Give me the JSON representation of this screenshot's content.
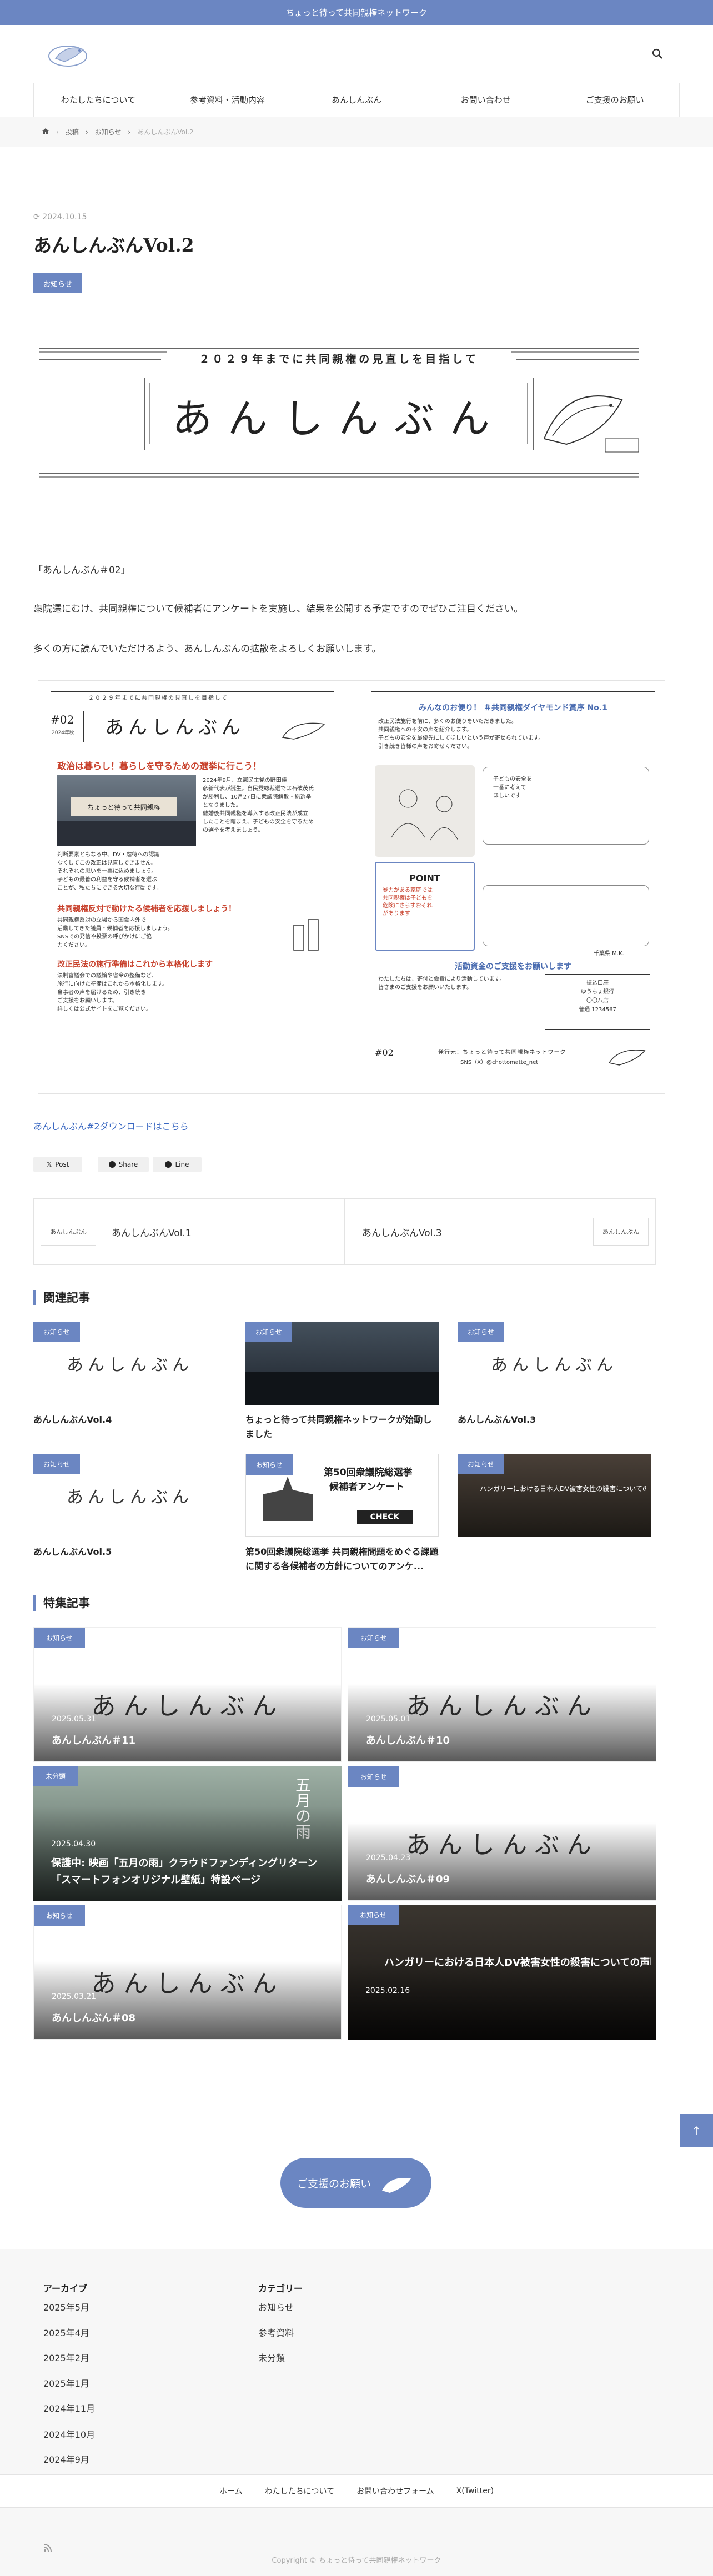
{
  "topbar": {
    "text": "ちょっと待って共同親権ネットワーク"
  },
  "nav": [
    "わたしたちについて",
    "参考資料・活動内容",
    "あんしんぶん",
    "お問い合わせ",
    "ご支援のお願い"
  ],
  "breadcrumb": {
    "items": [
      "投稿",
      "お知らせ"
    ],
    "current": "あんしんぶんVol.2"
  },
  "post": {
    "date": "2024.10.15",
    "title": "あんしんぶんVol.2",
    "category": "お知らせ"
  },
  "hero": {
    "tagline": "２０２９年までに共同親権の見直しを目指して",
    "title": "あんしんぶん"
  },
  "body": {
    "p1": "「あんしんぶん＃02」",
    "p2": "衆院選にむけ、共同親権について候補者にアンケートを実施し、結果を公開する予定ですのでぜひご注目ください。",
    "p3": "多くの方に読んでいただけるよう、あんしんぶんの拡散をよろしくお願いします。"
  },
  "newsletter": {
    "tagline": "２０２９年までに共同親権の見直しを目指して",
    "issue": "#02",
    "issue_sub": "2024年秋",
    "name": "あんしんぶん",
    "h1": "政治は暮らし！暮らしを守るための選挙に行こう！",
    "photo_caption": "ちょっと待って共同親権",
    "lines1": [
      "2024年9月、立憲民主党の野田佳",
      "彦新代表が誕生。自民党総裁選では石破茂氏",
      "が勝利し、10月27日に衆議院解散・総選挙",
      "となりました。"
    ],
    "lines2": [
      "離婚後共同親権を導入する改正民法が成立",
      "したことを踏まえ、子どもの安全を守るため",
      "の選挙を考えましょう。"
    ],
    "lines3": [
      "判断要素ともなる中、DV・虐待への認識",
      "なくしてこの改正は見直しできません。",
      "それぞれの思いを一票に込めましょう。"
    ],
    "lines4": [
      "子どもの最善の利益を守る候補者を選ぶ",
      "ことが、私たちにできる大切な行動です。"
    ],
    "h2": "共同親権反対で動けたる候補者を応援しましょう！",
    "lines5": [
      "共同親権反対の立場から国会内外で",
      "活動してきた議員・候補者を応援しましょう。"
    ],
    "lines6": [
      "SNSでの発信や投票の呼びかけにご協",
      "力ください。"
    ],
    "h3": "改正民法の施行準備はこれから本格化します",
    "lines7": [
      "法制審議会での議論や省令の整備など、",
      "施行に向けた準備はこれから本格化します。"
    ],
    "lines8": [
      "当事者の声を届けるため、引き続き",
      "ご支援をお願いします。"
    ],
    "lines9": [
      "詳しくは公式サイトをご覧ください。"
    ],
    "right_h1": "みんなのお便り！ ＃共同親権ダイヤモンド賞序 No.1",
    "right_lines": [
      "改正民法施行を前に、多くのお便りをいただきました。",
      "共同親権への不安の声を紹介します。",
      "子どもの安全を最優先にしてほしいという声が寄せられています。",
      "引き続き皆様の声をお寄せください。"
    ],
    "point": "POINT",
    "point_lines": [
      "暴力がある家庭では",
      "共同親権は子どもを",
      "危険にさらすおそれ",
      "があります"
    ],
    "speech_lines": [
      "子どもの安全を",
      "一番に考えて",
      "ほしいです"
    ],
    "signature": "千葉県 M.K.",
    "right_h2": "活動資金のご支援をお願いします",
    "donate_lines": [
      "わたしたちは、寄付と会費により活動しています。",
      "皆さまのご支援をお願いいたします。"
    ],
    "bank_title": "振込口座",
    "bank_lines": [
      "ゆうちょ銀行",
      "〇〇八店",
      "普通 1234567"
    ],
    "footer_left": "#02",
    "footer_center": "発行元：ちょっと待って共同親権ネットワーク",
    "footer_sub": "SNS（X）@chottomatte_net"
  },
  "download_link": "あんしんぶん#2ダウンロードはこちら",
  "share": [
    "Post",
    "Share",
    "Line"
  ],
  "prevnext": {
    "prev": "あんしんぶんVol.1",
    "next": "あんしんぶんVol.3"
  },
  "related": {
    "heading": "関連記事",
    "items": [
      {
        "tag": "お知らせ",
        "title": "あんしんぶんVol.4"
      },
      {
        "tag": "お知らせ",
        "title": "ちょっと待って共同親権ネットワークが始動しました"
      },
      {
        "tag": "お知らせ",
        "title": "あんしんぶんVol.3"
      },
      {
        "tag": "お知らせ",
        "title": "あんしんぶんVol.5"
      },
      {
        "tag": "お知らせ",
        "title": "第50回衆議院総選挙 共同親権問題をめぐる課題に関する各候補者の方針についてのアンケ..."
      },
      {
        "tag": "お知らせ",
        "title": ""
      }
    ]
  },
  "survey_card": {
    "line1": "第50回衆議院総選挙",
    "line2": "候補者アンケート",
    "check": "CHECK"
  },
  "hungary_text": "ハンガリーにおける日本人DV被害女性の殺害についての声明",
  "features": {
    "heading": "特集記事",
    "items": [
      {
        "tag": "お知らせ",
        "date": "2025.05.31",
        "title": "あんしんぶん＃11"
      },
      {
        "tag": "お知らせ",
        "date": "2025.05.01",
        "title": "あんしんぶん＃10"
      },
      {
        "tag": "未分類",
        "date": "2025.04.30",
        "title": "保護中: 映画「五月の雨」クラウドファンディングリターン「スマートフォンオリジナル壁紙」特設ページ"
      },
      {
        "tag": "お知らせ",
        "date": "2025.04.23",
        "title": "あんしんぶん＃09"
      },
      {
        "tag": "お知らせ",
        "date": "2025.03.21",
        "title": "あんしんぶん＃08"
      },
      {
        "tag": "お知らせ",
        "date": "2025.02.16",
        "title": "ハンガリーにおける日本人DV被害女性の殺害についての声明"
      }
    ]
  },
  "rain_text": "五月の雨",
  "support_label": "ご支援のお願い",
  "footer": {
    "archive_heading": "アーカイブ",
    "archives": [
      "2025年5月",
      "2025年4月",
      "2025年2月",
      "2025年1月",
      "2024年11月",
      "2024年10月",
      "2024年9月"
    ],
    "category_heading": "カテゴリー",
    "categories": [
      "お知らせ",
      "参考資料",
      "未分類"
    ],
    "nav": [
      "ホーム",
      "わたしたちについて",
      "お問い合わせフォーム",
      "X(Twitter)"
    ],
    "copyright": "Copyright © ちょっと待って共同親権ネットワーク"
  },
  "colors": {
    "accent": "#6b86c2",
    "link": "#3a68c2"
  },
  "icons": [
    "search-icon",
    "home-icon",
    "chevron-right-icon",
    "x-icon",
    "facebook-icon",
    "line-icon",
    "arrow-up-icon",
    "rss-icon",
    "bird-logo-icon"
  ]
}
